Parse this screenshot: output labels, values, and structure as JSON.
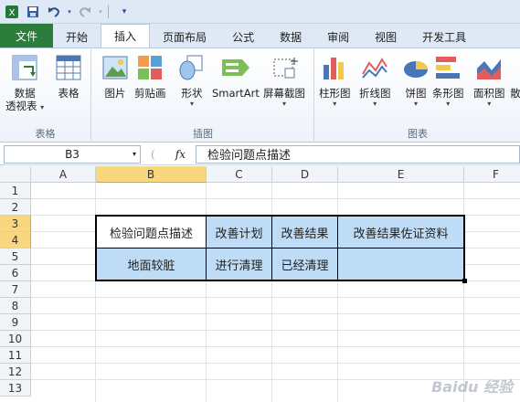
{
  "qat": {
    "app_icon": "excel-icon",
    "save": "save-icon",
    "undo": "undo-icon",
    "redo": "redo-icon",
    "customize": "customize-icon"
  },
  "tabs": [
    {
      "label": "文件"
    },
    {
      "label": "开始"
    },
    {
      "label": "插入"
    },
    {
      "label": "页面布局"
    },
    {
      "label": "公式"
    },
    {
      "label": "数据"
    },
    {
      "label": "审阅"
    },
    {
      "label": "视图"
    },
    {
      "label": "开发工具"
    }
  ],
  "active_tab": "插入",
  "ribbon": {
    "groups": {
      "tables": "表格",
      "illustrations": "插图",
      "charts": "图表"
    },
    "buttons": {
      "pivot_line1": "数据",
      "pivot_line2": "透视表",
      "table": "表格",
      "picture": "图片",
      "clipart": "剪贴画",
      "shapes": "形状",
      "smartart": "SmartArt",
      "screenshot": "屏幕截图",
      "column": "柱形图",
      "line": "折线图",
      "pie": "饼图",
      "bar": "条形图",
      "area": "面积图",
      "scatter_partial": "散"
    }
  },
  "formula_bar": {
    "name_box": "B3",
    "fx": "fx",
    "value": "检验问题点描述"
  },
  "columns": [
    "A",
    "B",
    "C",
    "D",
    "E",
    "F"
  ],
  "rows": [
    "1",
    "2",
    "3",
    "4",
    "5",
    "6",
    "7",
    "8",
    "9",
    "10",
    "11",
    "12",
    "13"
  ],
  "table": {
    "header": [
      "检验问题点描述",
      "改善计划",
      "改善结果",
      "改善结果佐证资料"
    ],
    "row1": [
      "地面较脏",
      "进行清理",
      "已经清理",
      ""
    ]
  },
  "watermark": "Baidu 经验"
}
